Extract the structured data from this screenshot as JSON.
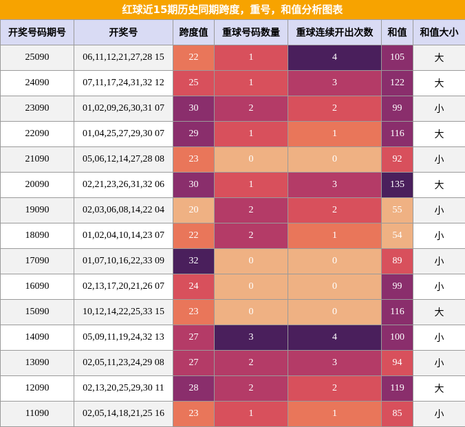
{
  "title": "红球近15期历史同期跨度，重号，和值分析图表",
  "headers": [
    "开奖号码期号",
    "开奖号",
    "跨度值",
    "重球号码数量",
    "重球连续开出次数",
    "和值",
    "和值大小"
  ],
  "rows": [
    {
      "issue": "25090",
      "numbers": "06,11,12,21,27,28 15",
      "span": "22",
      "repeat_count": "1",
      "repeat_streak": "4",
      "sum": "105",
      "size": "大"
    },
    {
      "issue": "24090",
      "numbers": "07,11,17,24,31,32 12",
      "span": "25",
      "repeat_count": "1",
      "repeat_streak": "3",
      "sum": "122",
      "size": "大"
    },
    {
      "issue": "23090",
      "numbers": "01,02,09,26,30,31 07",
      "span": "30",
      "repeat_count": "2",
      "repeat_streak": "2",
      "sum": "99",
      "size": "小"
    },
    {
      "issue": "22090",
      "numbers": "01,04,25,27,29,30 07",
      "span": "29",
      "repeat_count": "1",
      "repeat_streak": "1",
      "sum": "116",
      "size": "大"
    },
    {
      "issue": "21090",
      "numbers": "05,06,12,14,27,28 08",
      "span": "23",
      "repeat_count": "0",
      "repeat_streak": "0",
      "sum": "92",
      "size": "小"
    },
    {
      "issue": "20090",
      "numbers": "02,21,23,26,31,32 06",
      "span": "30",
      "repeat_count": "1",
      "repeat_streak": "3",
      "sum": "135",
      "size": "大"
    },
    {
      "issue": "19090",
      "numbers": "02,03,06,08,14,22 04",
      "span": "20",
      "repeat_count": "2",
      "repeat_streak": "2",
      "sum": "55",
      "size": "小"
    },
    {
      "issue": "18090",
      "numbers": "01,02,04,10,14,23 07",
      "span": "22",
      "repeat_count": "2",
      "repeat_streak": "1",
      "sum": "54",
      "size": "小"
    },
    {
      "issue": "17090",
      "numbers": "01,07,10,16,22,33 09",
      "span": "32",
      "repeat_count": "0",
      "repeat_streak": "0",
      "sum": "89",
      "size": "小"
    },
    {
      "issue": "16090",
      "numbers": "02,13,17,20,21,26 07",
      "span": "24",
      "repeat_count": "0",
      "repeat_streak": "0",
      "sum": "99",
      "size": "小"
    },
    {
      "issue": "15090",
      "numbers": "10,12,14,22,25,33 15",
      "span": "23",
      "repeat_count": "0",
      "repeat_streak": "0",
      "sum": "116",
      "size": "大"
    },
    {
      "issue": "14090",
      "numbers": "05,09,11,19,24,32 13",
      "span": "27",
      "repeat_count": "3",
      "repeat_streak": "4",
      "sum": "100",
      "size": "小"
    },
    {
      "issue": "13090",
      "numbers": "02,05,11,23,24,29 08",
      "span": "27",
      "repeat_count": "2",
      "repeat_streak": "3",
      "sum": "94",
      "size": "小"
    },
    {
      "issue": "12090",
      "numbers": "02,13,20,25,29,30 11",
      "span": "28",
      "repeat_count": "2",
      "repeat_streak": "2",
      "sum": "119",
      "size": "大"
    },
    {
      "issue": "11090",
      "numbers": "02,05,14,18,21,25 16",
      "span": "23",
      "repeat_count": "1",
      "repeat_streak": "1",
      "sum": "85",
      "size": "小"
    }
  ],
  "colors": {
    "title_bg": "#f7a300",
    "header_bg": "#d9dbf4",
    "heat_low": "#efb183",
    "heat_mid_low": "#e9765a",
    "heat_mid": "#d8505c",
    "heat_mid_high": "#b43b67",
    "heat_high": "#8a2e6c",
    "heat_max": "#4a1f5c"
  }
}
